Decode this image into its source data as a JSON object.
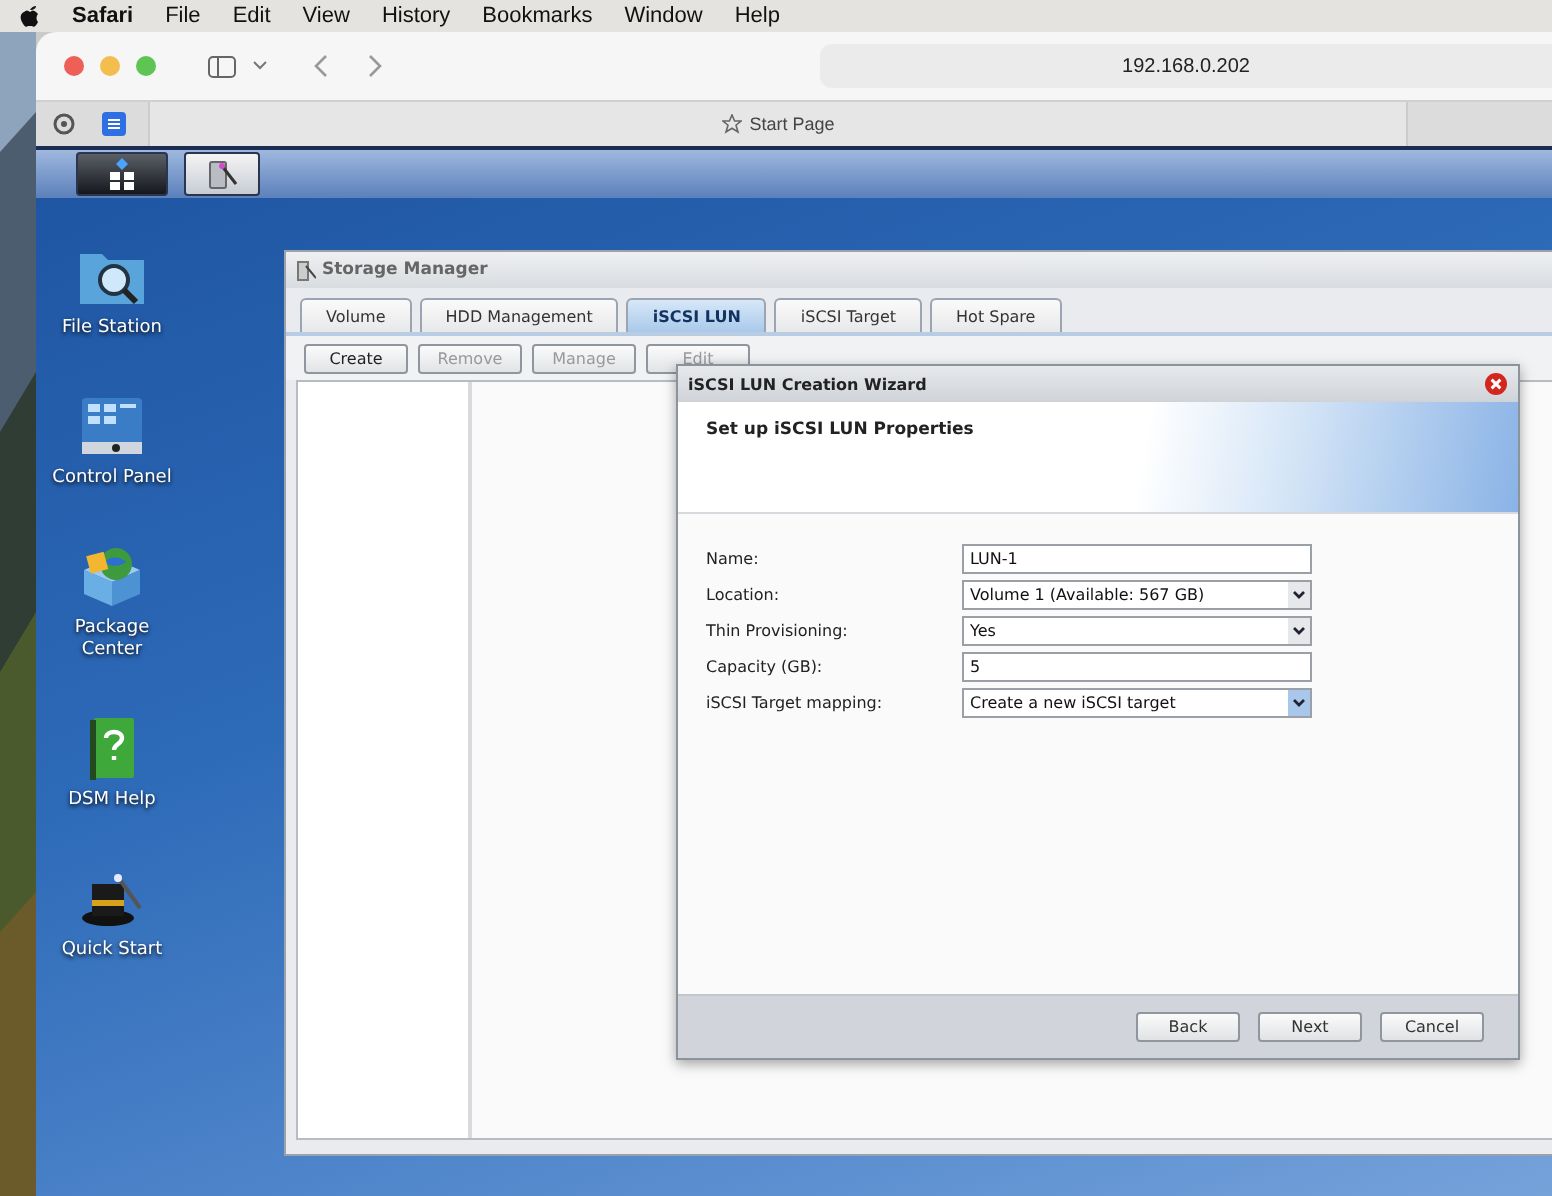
{
  "menu_bar": {
    "app_name": "Safari",
    "menus": [
      "File",
      "Edit",
      "View",
      "History",
      "Bookmarks",
      "Window",
      "Help"
    ]
  },
  "browser": {
    "address": "192.168.0.202",
    "tab_title": "Start Page"
  },
  "taskbar": {
    "apps": [
      {
        "kind": "grid",
        "selected": true
      },
      {
        "kind": "storage",
        "selected": false
      }
    ]
  },
  "desktop_icons": [
    {
      "kind": "folder",
      "label": "File Station"
    },
    {
      "kind": "panel",
      "label": "Control Panel"
    },
    {
      "kind": "package",
      "label": "Package Center"
    },
    {
      "kind": "help",
      "label": "DSM Help"
    },
    {
      "kind": "hat",
      "label": "Quick Start"
    }
  ],
  "storage_manager": {
    "title": "Storage Manager",
    "tabs": [
      {
        "label": "Volume",
        "selected": false
      },
      {
        "label": "HDD Management",
        "selected": false
      },
      {
        "label": "iSCSI LUN",
        "selected": true
      },
      {
        "label": "iSCSI Target",
        "selected": false
      },
      {
        "label": "Hot Spare",
        "selected": false
      }
    ],
    "toolbar": [
      {
        "label": "Create",
        "disabled": false
      },
      {
        "label": "Remove",
        "disabled": true
      },
      {
        "label": "Manage",
        "disabled": true
      },
      {
        "label": "Edit",
        "disabled": true
      }
    ]
  },
  "wizard": {
    "title": "iSCSI LUN Creation Wizard",
    "heading": "Set up iSCSI LUN Properties",
    "fields": [
      {
        "label": "Name:",
        "value": "LUN-1",
        "kind": "text"
      },
      {
        "label": "Location:",
        "value": "Volume 1 (Available: 567 GB)",
        "kind": "select"
      },
      {
        "label": "Thin Provisioning:",
        "value": "Yes",
        "kind": "select"
      },
      {
        "label": "Capacity (GB):",
        "value": "5",
        "kind": "text"
      },
      {
        "label": "iSCSI Target mapping:",
        "value": "Create a new iSCSI target",
        "kind": "select"
      }
    ],
    "buttons": [
      "Back",
      "Next",
      "Cancel"
    ]
  }
}
